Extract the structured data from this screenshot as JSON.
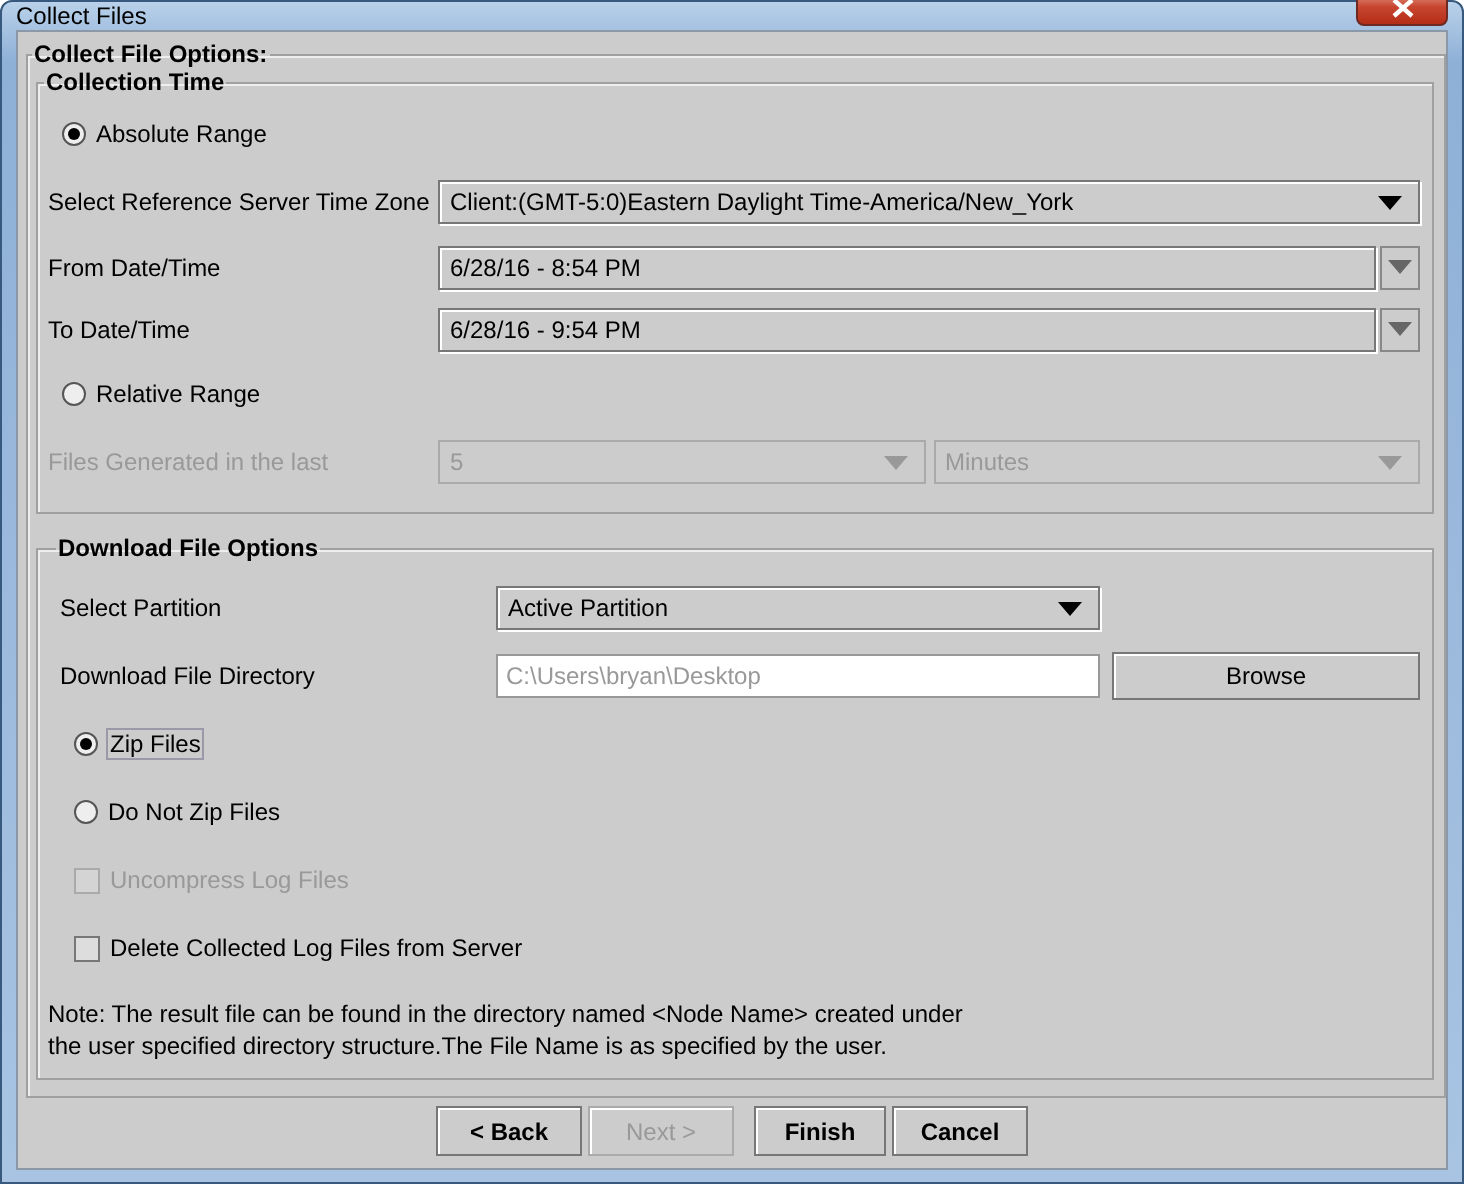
{
  "window": {
    "title": "Collect Files"
  },
  "options_group": {
    "title": "Collect File Options:"
  },
  "collection_time": {
    "title": "Collection Time",
    "absolute_range": {
      "label": "Absolute Range",
      "selected": true
    },
    "time_zone": {
      "label": "Select Reference Server Time Zone",
      "value": "Client:(GMT-5:0)Eastern Daylight Time-America/New_York"
    },
    "from": {
      "label": "From Date/Time",
      "value": "6/28/16 - 8:54 PM"
    },
    "to": {
      "label": "To Date/Time",
      "value": "6/28/16 - 9:54 PM"
    },
    "relative_range": {
      "label": "Relative Range",
      "selected": false
    },
    "files_generated": {
      "label": "Files Generated in the last",
      "disabled": true,
      "count": "5",
      "unit": "Minutes"
    }
  },
  "download": {
    "title": "Download File Options",
    "partition": {
      "label": "Select Partition",
      "value": "Active Partition"
    },
    "directory": {
      "label": "Download File Directory",
      "value": "C:\\Users\\bryan\\Desktop",
      "disabled": true
    },
    "browse": "Browse",
    "zip_options": [
      {
        "label": "Zip Files",
        "selected": true,
        "focused": true
      },
      {
        "label": "Do Not Zip Files",
        "selected": false,
        "focused": false
      }
    ],
    "checkboxes": [
      {
        "label": "Uncompress Log Files",
        "checked": false,
        "disabled": true
      },
      {
        "label": "Delete Collected Log Files from Server",
        "checked": false,
        "disabled": false
      }
    ],
    "note": "Note: The result file can be found in the directory named <Node Name> created under\nthe user specified directory structure.The File Name is as specified by the user."
  },
  "buttons": [
    {
      "label": "< Back",
      "disabled": false
    },
    {
      "label": "Next >",
      "disabled": true
    },
    {
      "label": "Finish",
      "disabled": false
    },
    {
      "label": "Cancel",
      "disabled": false
    }
  ]
}
